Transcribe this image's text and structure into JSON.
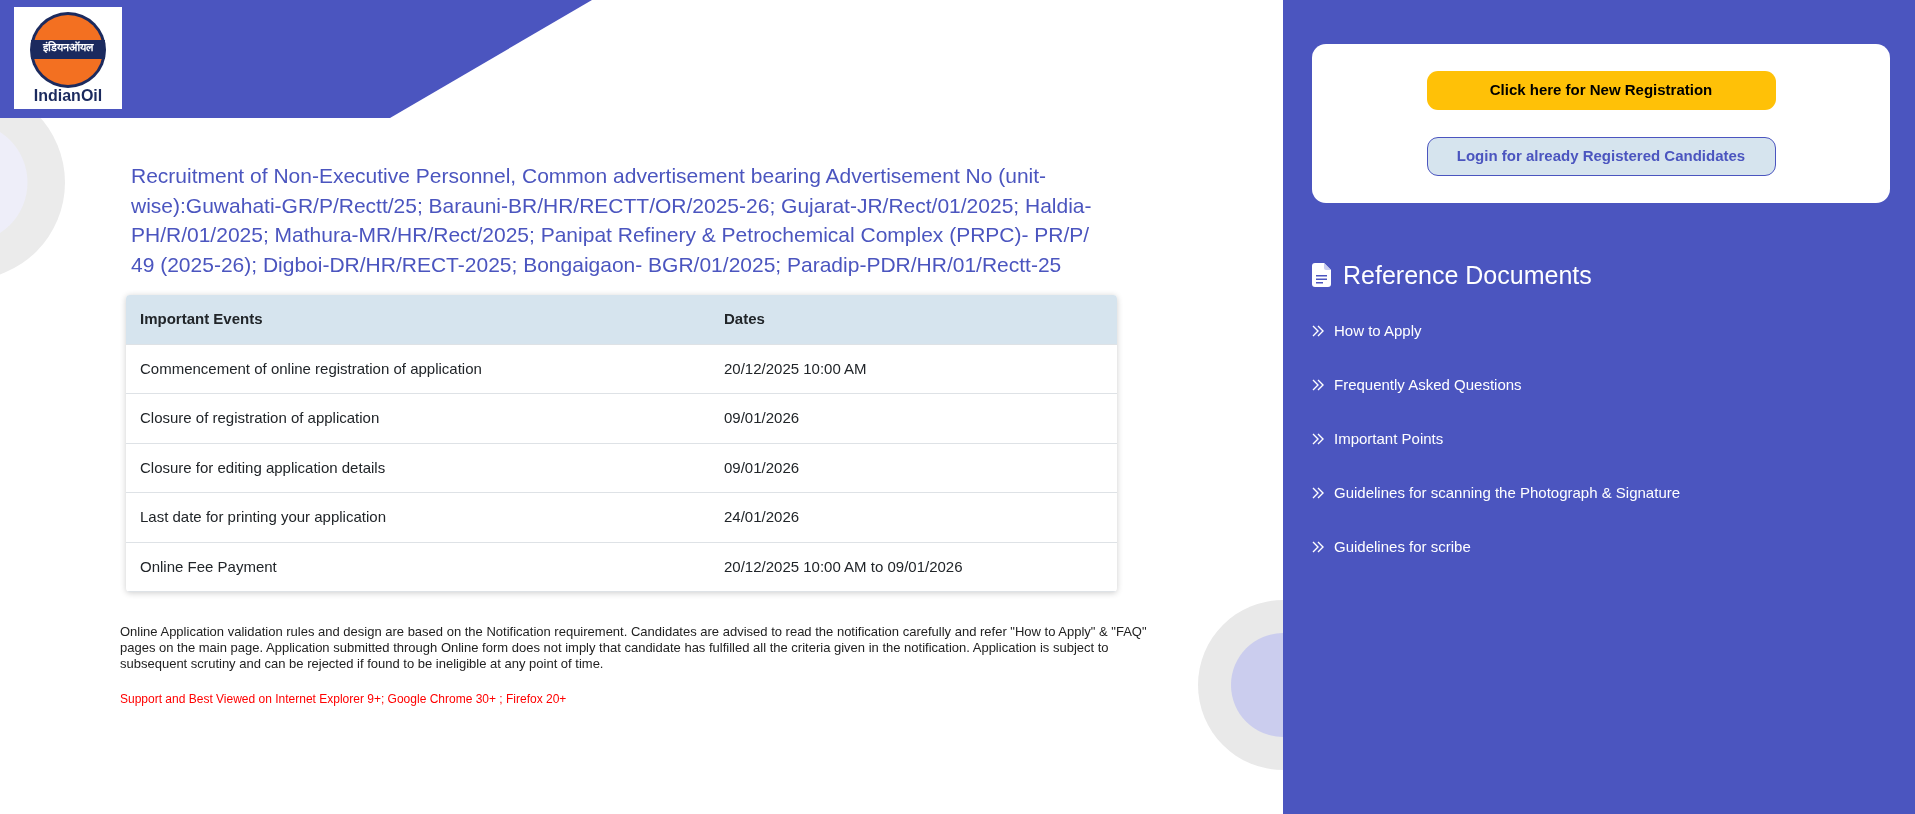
{
  "logo": {
    "hindi_text": "इंडियनऑयल",
    "text": "IndianOil"
  },
  "title": "Recruitment of Non-Executive Personnel, Common advertisement bearing Advertisement No (unit-wise):Guwahati-GR/P/Rectt/25; Barauni-BR/HR/RECTT/OR/2025-26; Gujarat-JR/Rect/01/2025; Haldia-PH/R/01/2025; Mathura-MR/HR/Rect/2025; Panipat Refinery & Petrochemical Complex (PRPC)- PR/P/ 49 (2025-26); Digboi-DR/HR/RECT-2025; Bongaigaon- BGR/01/2025; Paradip-PDR/HR/01/Rectt-25",
  "table": {
    "columns": [
      "Important Events",
      "Dates"
    ],
    "rows": [
      [
        "Commencement of online registration of application",
        "20/12/2025 10:00 AM"
      ],
      [
        "Closure of registration of application",
        "09/01/2026"
      ],
      [
        "Closure for editing application details",
        "09/01/2026"
      ],
      [
        "Last date for printing your application",
        "24/01/2026"
      ],
      [
        "Online Fee Payment",
        "20/12/2025 10:00 AM to 09/01/2026"
      ]
    ]
  },
  "notice": "Online Application validation rules and design are based on the Notification requirement. Candidates are advised to read the notification carefully and refer \"How to Apply\" & \"FAQ\" pages on the main page. Application submitted through Online form does not imply that candidate has fulfilled all the criteria given in the notification. Application is subject to subsequent scrutiny and can be rejected if found to be ineligible at any point of time.",
  "browser_support": "Support and Best Viewed on Internet Explorer 9+; Google Chrome 30+ ; Firefox 20+",
  "buttons": [
    {
      "kind": "primary",
      "label": "Click here for New Registration"
    },
    {
      "kind": "secondary",
      "label": "Login for already Registered Candidates"
    }
  ],
  "reference_documents": {
    "heading": "Reference Documents",
    "items": [
      "How to Apply",
      "Frequently Asked Questions",
      "Important Points",
      "Guidelines for scanning the Photograph & Signature",
      "Guidelines for scribe"
    ]
  }
}
